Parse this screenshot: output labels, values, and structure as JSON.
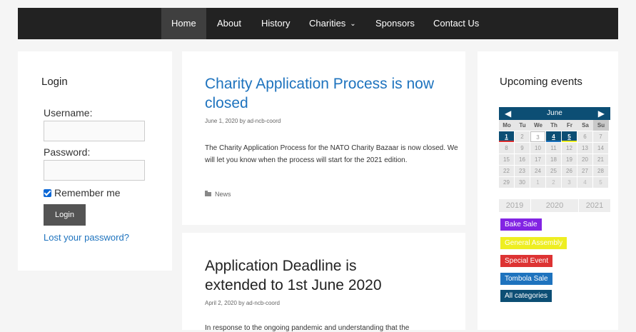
{
  "nav": {
    "items": [
      {
        "label": "Home",
        "active": true
      },
      {
        "label": "About"
      },
      {
        "label": "History"
      },
      {
        "label": "Charities"
      },
      {
        "label": "Sponsors"
      },
      {
        "label": "Contact Us"
      }
    ]
  },
  "login": {
    "title": "Login",
    "username_label": "Username:",
    "username_value": "",
    "password_label": "Password:",
    "password_value": "",
    "remember_label": "Remember me",
    "remember_checked": true,
    "button_label": "Login",
    "lost_link": "Lost your password?"
  },
  "posts": [
    {
      "title": "Charity Application Process is now closed",
      "date": "June 1, 2020",
      "by": "by",
      "author": "ad-ncb-coord",
      "excerpt": "The Charity Application Process for the NATO Charity Bazaar is now closed. We will let you know when the process will start for the 2021 edition.",
      "category": "News"
    },
    {
      "title": "Application Deadline is extended to 1st June 2020",
      "date": "April 2, 2020",
      "by": "by",
      "author": "ad-ncb-coord",
      "excerpt": "In response to the ongoing pandemic and understanding that the"
    }
  ],
  "events": {
    "title": "Upcoming events",
    "calendar": {
      "month": "June",
      "prev_icon": "◀",
      "next_icon": "▶",
      "weekdays": [
        "Mo",
        "Tu",
        "We",
        "Th",
        "Fr",
        "Sa",
        "Su"
      ],
      "weeks": [
        [
          "1",
          "2",
          "3",
          "4",
          "5",
          "6",
          "7"
        ],
        [
          "8",
          "9",
          "10",
          "11",
          "12",
          "13",
          "14"
        ],
        [
          "15",
          "16",
          "17",
          "18",
          "19",
          "20",
          "21"
        ],
        [
          "22",
          "23",
          "24",
          "25",
          "26",
          "27",
          "28"
        ],
        [
          "29",
          "30",
          "1",
          "2",
          "3",
          "4",
          "5"
        ]
      ],
      "years": [
        "2019",
        "2020",
        "2021"
      ]
    },
    "categories": [
      {
        "label": "Bake Sale",
        "color": "#8224e3"
      },
      {
        "label": "General Assembly",
        "color": "#eeee22"
      },
      {
        "label": "Special Event",
        "color": "#dd3333"
      },
      {
        "label": "Tombola Sale",
        "color": "#1e73be"
      },
      {
        "label": "All categories",
        "color": "#0c4e74"
      }
    ]
  },
  "colors": {
    "nav_bg": "#222222",
    "nav_active": "#3f3f3f",
    "link": "#1e73be",
    "calendar_header": "#0c4e74"
  }
}
